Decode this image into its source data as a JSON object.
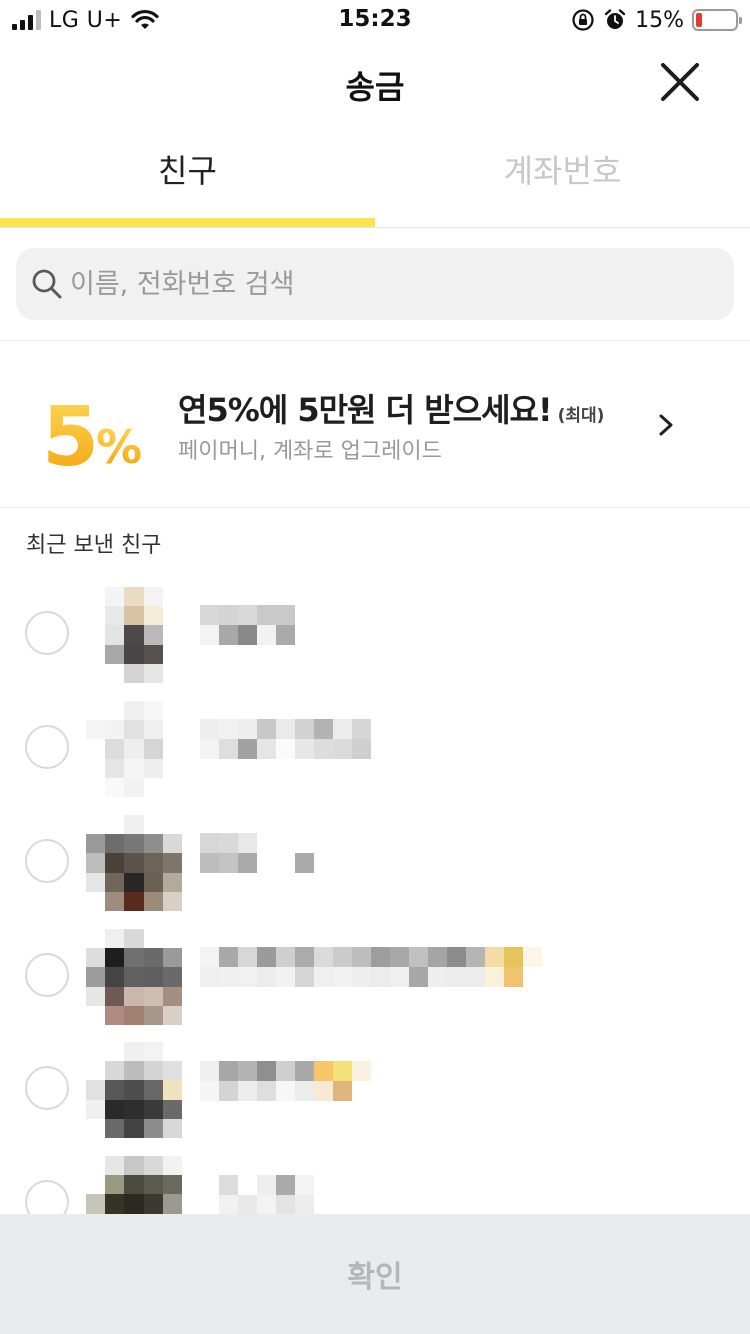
{
  "status_bar": {
    "carrier": "LG U+",
    "time": "15:23",
    "battery_percent": "15%",
    "battery_level": 0.15,
    "battery_color": "#e53b2e",
    "icons": [
      "signal-icon",
      "wifi-icon",
      "rotation-lock-icon",
      "alarm-icon",
      "battery-icon"
    ]
  },
  "header": {
    "title": "송금",
    "close_icon": "close-icon"
  },
  "tabs": [
    {
      "label": "친구",
      "active": true
    },
    {
      "label": "계좌번호",
      "active": false
    }
  ],
  "accent_color": "#fae64c",
  "search": {
    "placeholder": "이름, 전화번호 검색",
    "value": ""
  },
  "promo": {
    "badge": "5%",
    "title": "연5%에 5만원 더 받으세요!",
    "title_suffix": "(최대)",
    "subtitle": "페이머니, 계좌로 업그레이드"
  },
  "recent": {
    "section_title": "최근 보낸 친구",
    "friends": [
      {
        "name": "",
        "selected": false
      },
      {
        "name": "",
        "selected": false
      },
      {
        "name": "",
        "selected": false
      },
      {
        "name": "",
        "selected": false
      },
      {
        "name": "",
        "selected": false
      },
      {
        "name": "",
        "selected": false
      }
    ]
  },
  "confirm": {
    "label": "확인",
    "enabled": false
  }
}
